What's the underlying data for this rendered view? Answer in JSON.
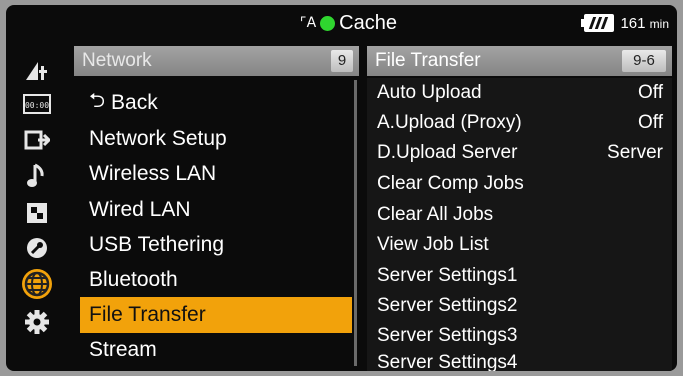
{
  "status_bar": {
    "media_label": "Cache",
    "battery_value": "161",
    "battery_unit": "min",
    "media_icon_glyph": "⌜A",
    "indicator_color": "#2fd62f"
  },
  "rail": {
    "icons": [
      "camera-settings-icon",
      "timecode-icon",
      "output-icon",
      "audio-icon",
      "shading-icon",
      "maintenance-icon",
      "network-icon",
      "system-icon"
    ],
    "active_index": 6,
    "accent_color": "#f2a20b"
  },
  "network_menu": {
    "title": "Network",
    "page_badge": "9",
    "items": [
      {
        "label": "Back"
      },
      {
        "label": "Network Setup"
      },
      {
        "label": "Wireless LAN"
      },
      {
        "label": "Wired LAN"
      },
      {
        "label": "USB Tethering"
      },
      {
        "label": "Bluetooth"
      },
      {
        "label": "File Transfer"
      },
      {
        "label": "Stream"
      }
    ],
    "selected_index": 6
  },
  "file_transfer_menu": {
    "title": "File Transfer",
    "page_badge": "9-6",
    "items": [
      {
        "label": "Auto Upload",
        "value": "Off"
      },
      {
        "label": "A.Upload (Proxy)",
        "value": "Off"
      },
      {
        "label": "D.Upload Server",
        "value": "Server"
      },
      {
        "label": "Clear Comp Jobs",
        "value": ""
      },
      {
        "label": "Clear All Jobs",
        "value": ""
      },
      {
        "label": "View Job List",
        "value": ""
      },
      {
        "label": "Server Settings1",
        "value": ""
      },
      {
        "label": "Server Settings2",
        "value": ""
      },
      {
        "label": "Server Settings3",
        "value": ""
      },
      {
        "label": "Server Settings4",
        "value": ""
      }
    ]
  }
}
